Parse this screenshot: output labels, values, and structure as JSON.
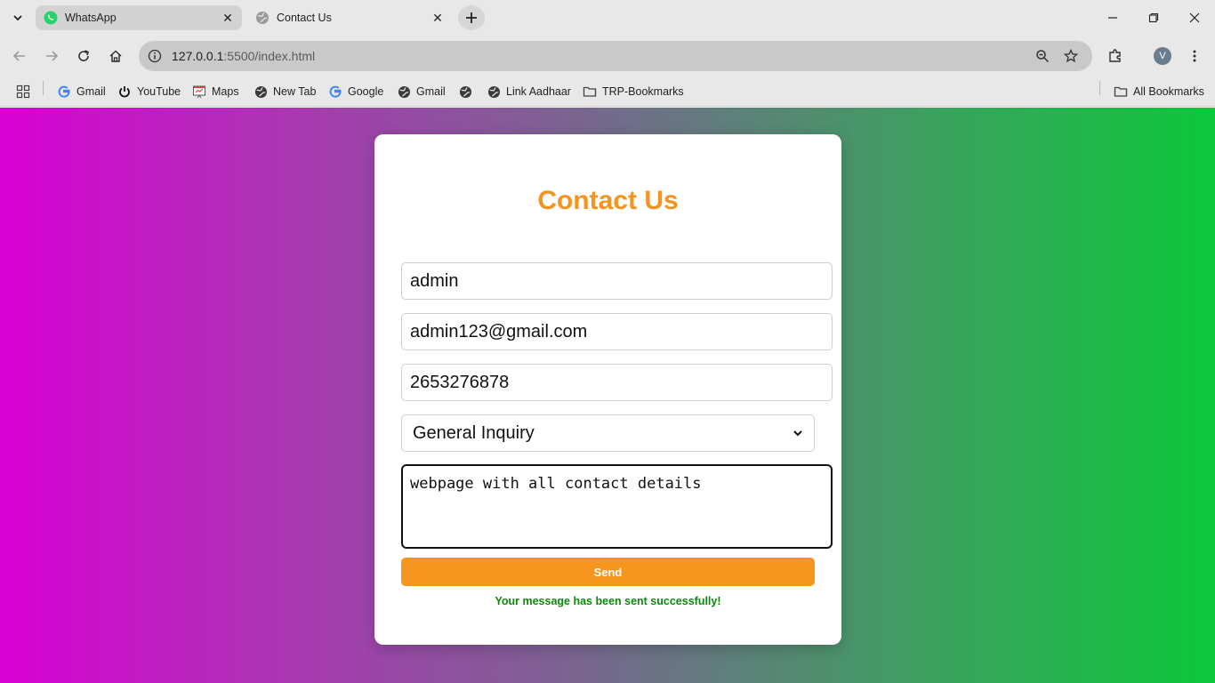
{
  "tabs": [
    {
      "title": "WhatsApp",
      "icon": "whatsapp-icon",
      "active": false
    },
    {
      "title": "Contact Us",
      "icon": "globe-icon",
      "active": true
    }
  ],
  "omnibox": {
    "host": "127.0.0.1",
    "path": ":5500/index.html"
  },
  "profile_initial": "V",
  "bookmarks": [
    {
      "label": "Gmail",
      "icon": "google-icon"
    },
    {
      "label": "YouTube",
      "icon": "power-icon"
    },
    {
      "label": "Maps",
      "icon": "maps-icon"
    },
    {
      "label": "New Tab",
      "icon": "globe-icon"
    },
    {
      "label": "Google",
      "icon": "google-icon"
    },
    {
      "label": "Gmail",
      "icon": "globe-icon"
    },
    {
      "label": "",
      "icon": "globe-icon"
    },
    {
      "label": "Link Aadhaar",
      "icon": "globe-icon"
    },
    {
      "label": "TRP-Bookmarks",
      "icon": "folder-icon"
    }
  ],
  "all_bookmarks_label": "All Bookmarks",
  "form": {
    "title": "Contact Us",
    "name_value": "admin",
    "email_value": "admin123@gmail.com",
    "phone_value": "2653276878",
    "subject_selected": "General Inquiry",
    "message_value": "webpage with all contact details",
    "send_label": "Send",
    "success_message": "Your message has been sent successfully!"
  },
  "colors": {
    "gradient_start": "#d800d4",
    "gradient_end": "#0cc83a",
    "title_color": "#f39320",
    "button_color": "#f7961f",
    "success_color": "#0a8a0a"
  }
}
